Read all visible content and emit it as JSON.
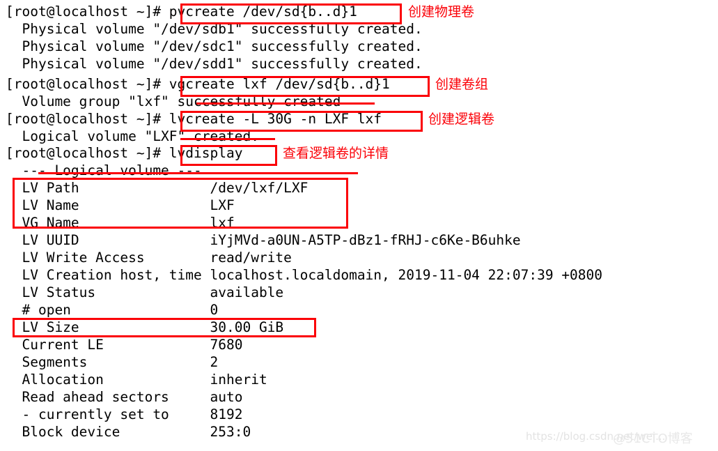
{
  "terminal": {
    "prompt": "[root@localhost ~]#",
    "lines": [
      {
        "id": "l0",
        "text": "[root@localhost ~]# pvcreate /dev/sd{b..d}1"
      },
      {
        "id": "l1",
        "text": "  Physical volume \"/dev/sdb1\" successfully created."
      },
      {
        "id": "l2",
        "text": "  Physical volume \"/dev/sdc1\" successfully created."
      },
      {
        "id": "l3",
        "text": "  Physical volume \"/dev/sdd1\" successfully created."
      },
      {
        "id": "l4",
        "text": "[root@localhost ~]# vgcreate lxf /dev/sd{b..d}1"
      },
      {
        "id": "l5",
        "text": "  Volume group \"lxf\" successfully created"
      },
      {
        "id": "l6",
        "text": "[root@localhost ~]# lvcreate -L 30G -n LXF lxf"
      },
      {
        "id": "l7",
        "text": "  Logical volume \"LXF\" created."
      },
      {
        "id": "l8",
        "text": "[root@localhost ~]# lvdisplay"
      },
      {
        "id": "l9",
        "text": "  --- Logical volume ---"
      },
      {
        "id": "l10",
        "text": "  LV Path                /dev/lxf/LXF"
      },
      {
        "id": "l11",
        "text": "  LV Name                LXF"
      },
      {
        "id": "l12",
        "text": "  VG Name                lxf"
      },
      {
        "id": "l13",
        "text": "  LV UUID                iYjMVd-a0UN-A5TP-dBz1-fRHJ-c6Ke-B6uhke"
      },
      {
        "id": "l14",
        "text": "  LV Write Access        read/write"
      },
      {
        "id": "l15",
        "text": "  LV Creation host, time localhost.localdomain, 2019-11-04 22:07:39 +0800"
      },
      {
        "id": "l16",
        "text": "  LV Status              available"
      },
      {
        "id": "l17",
        "text": "  # open                 0"
      },
      {
        "id": "l18",
        "text": "  LV Size                30.00 GiB"
      },
      {
        "id": "l19",
        "text": "  Current LE             7680"
      },
      {
        "id": "l20",
        "text": "  Segments               2"
      },
      {
        "id": "l21",
        "text": "  Allocation             inherit"
      },
      {
        "id": "l22",
        "text": "  Read ahead sectors     auto"
      },
      {
        "id": "l23",
        "text": "  - currently set to     8192"
      },
      {
        "id": "l24",
        "text": "  Block device           253:0"
      }
    ],
    "commands": [
      {
        "id": "c0",
        "command": "pvcreate /dev/sd{b..d}1"
      },
      {
        "id": "c1",
        "command": "vgcreate lxf /dev/sd{b..d}1"
      },
      {
        "id": "c2",
        "command": "lvcreate -L 30G -n LXF lxf"
      },
      {
        "id": "c3",
        "command": "lvdisplay"
      }
    ],
    "lv_details": {
      "header": "--- Logical volume ---",
      "fields": [
        {
          "label": "LV Path",
          "value": "/dev/lxf/LXF"
        },
        {
          "label": "LV Name",
          "value": "LXF"
        },
        {
          "label": "VG Name",
          "value": "lxf"
        },
        {
          "label": "LV UUID",
          "value": "iYjMVd-a0UN-A5TP-dBz1-fRHJ-c6Ke-B6uhke"
        },
        {
          "label": "LV Write Access",
          "value": "read/write"
        },
        {
          "label": "LV Creation host, time",
          "value": "localhost.localdomain, 2019-11-04 22:07:39 +0800"
        },
        {
          "label": "LV Status",
          "value": "available"
        },
        {
          "label": "# open",
          "value": "0"
        },
        {
          "label": "LV Size",
          "value": "30.00 GiB"
        },
        {
          "label": "Current LE",
          "value": "7680"
        },
        {
          "label": "Segments",
          "value": "2"
        },
        {
          "label": "Allocation",
          "value": "inherit"
        },
        {
          "label": "Read ahead sectors",
          "value": "auto"
        },
        {
          "label": "- currently set to",
          "value": "8192"
        },
        {
          "label": "Block device",
          "value": "253:0"
        }
      ]
    }
  },
  "annotations": {
    "color": "#fb0007",
    "notes": [
      {
        "id": "n0",
        "text": "创建物理卷"
      },
      {
        "id": "n1",
        "text": "创建卷组"
      },
      {
        "id": "n2",
        "text": "创建逻辑卷"
      },
      {
        "id": "n3",
        "text": "查看逻辑卷的详情"
      }
    ]
  },
  "watermarks": {
    "csdn": "https://blog.csdn.net/wei...",
    "cto": "@51CTO博客"
  }
}
